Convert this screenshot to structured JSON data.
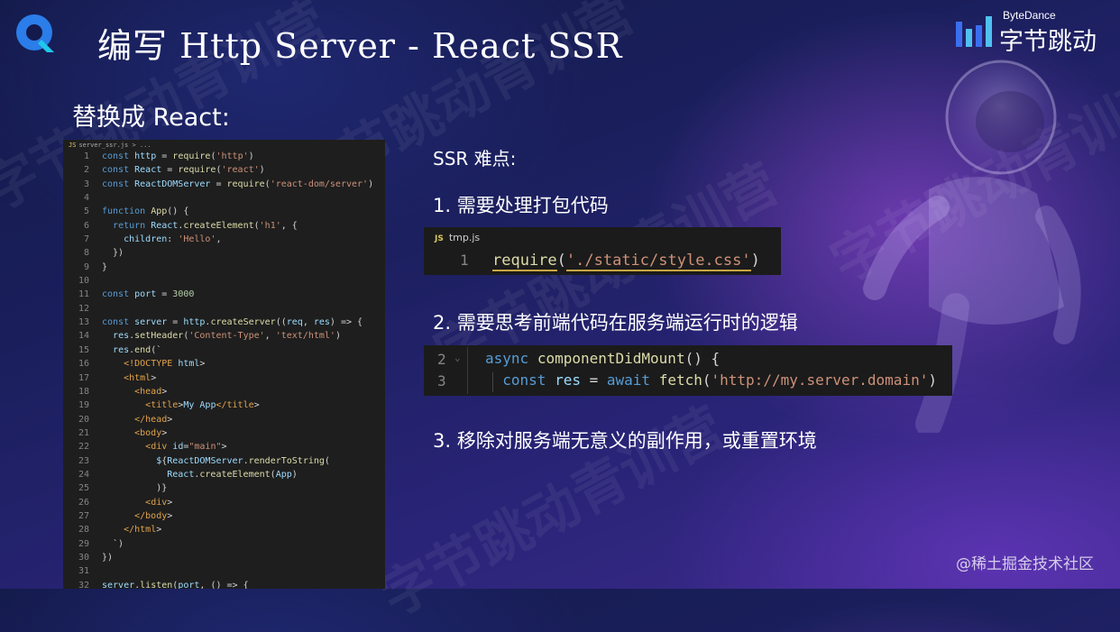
{
  "header": {
    "title": "编写 Http Server -  React SSR",
    "brand_en": "ByteDance",
    "brand_cn": "字节跳动"
  },
  "subtitle": "替换成 React:",
  "watermark": "字节跳动青训营",
  "editor": {
    "tab": "server_ssr.js > ...",
    "lines": [
      {
        "n": "1",
        "t": "const http = require('http')"
      },
      {
        "n": "2",
        "t": "const React = require('react')"
      },
      {
        "n": "3",
        "t": "const ReactDOMServer = require('react-dom/server')"
      },
      {
        "n": "4",
        "t": ""
      },
      {
        "n": "5",
        "t": "function App() {"
      },
      {
        "n": "6",
        "t": "  return React.createElement('h1', {"
      },
      {
        "n": "7",
        "t": "    children: 'Hello',"
      },
      {
        "n": "8",
        "t": "  })"
      },
      {
        "n": "9",
        "t": "}"
      },
      {
        "n": "10",
        "t": ""
      },
      {
        "n": "11",
        "t": "const port = 3000"
      },
      {
        "n": "12",
        "t": ""
      },
      {
        "n": "13",
        "t": "const server = http.createServer((req, res) => {"
      },
      {
        "n": "14",
        "t": "  res.setHeader('Content-Type', 'text/html')"
      },
      {
        "n": "15",
        "t": "  res.end(`"
      },
      {
        "n": "16",
        "t": "    <!DOCTYPE html>"
      },
      {
        "n": "17",
        "t": "    <html>"
      },
      {
        "n": "18",
        "t": "      <head>"
      },
      {
        "n": "19",
        "t": "        <title>My App</title>"
      },
      {
        "n": "20",
        "t": "      </head>"
      },
      {
        "n": "21",
        "t": "      <body>"
      },
      {
        "n": "22",
        "t": "        <div id=\"main\">"
      },
      {
        "n": "23",
        "t": "          ${ReactDOMServer.renderToString("
      },
      {
        "n": "24",
        "t": "            React.createElement(App)"
      },
      {
        "n": "25",
        "t": "          )}"
      },
      {
        "n": "26",
        "t": "        <div>"
      },
      {
        "n": "27",
        "t": "      </body>"
      },
      {
        "n": "28",
        "t": "    </html>"
      },
      {
        "n": "29",
        "t": "  `)"
      },
      {
        "n": "30",
        "t": "})"
      },
      {
        "n": "31",
        "t": ""
      },
      {
        "n": "32",
        "t": "server.listen(port, () => {"
      }
    ]
  },
  "ssr_title": "SSR 难点:",
  "points": [
    "1. 需要处理打包代码",
    "2. 需要思考前端代码在服务端运行时的逻辑",
    "3. 移除对服务端无意义的副作用，或重置环境"
  ],
  "snippet1": {
    "badge": "JS",
    "filename": "tmp.js",
    "line_no": "1",
    "code": "require('./static/style.css')"
  },
  "snippet2": {
    "line_a": "2",
    "line_b": "3",
    "code_a": "async componentDidMount() {",
    "code_b": "const res = await fetch('http://my.server.domain')"
  },
  "footer": "@稀土掘金技术社区",
  "colors": {
    "accent_keyword": "#569cd6",
    "accent_string": "#ce9178",
    "accent_function": "#dcdcaa"
  }
}
